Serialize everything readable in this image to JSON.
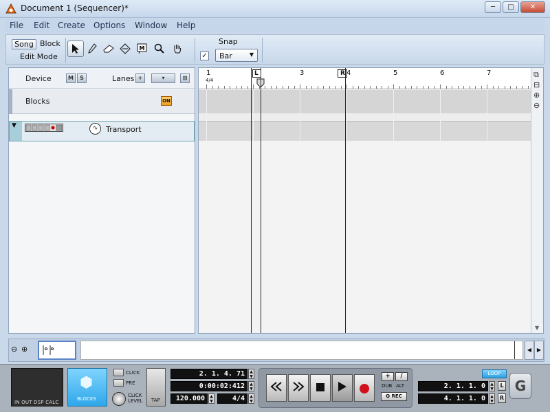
{
  "window": {
    "title": "Document 1 (Sequencer)*",
    "controls": {
      "minimize": "─",
      "maximize": "□",
      "close": "✕"
    }
  },
  "menu": [
    "File",
    "Edit",
    "Create",
    "Options",
    "Window",
    "Help"
  ],
  "toolbar": {
    "edit_mode": {
      "song": "Song",
      "block": "Block",
      "label": "Edit Mode"
    },
    "tools": [
      "arrow-icon",
      "pencil-icon",
      "eraser-icon",
      "razor-icon",
      "mute-icon",
      "magnify-icon",
      "hand-icon"
    ],
    "snap": {
      "label": "Snap",
      "checked": true,
      "check_glyph": "✓",
      "value": "Bar"
    }
  },
  "tracklist": {
    "device_label": "Device",
    "mute_label": "M",
    "solo_label": "S",
    "lanes_label": "Lanes",
    "blocks_label": "Blocks",
    "on_label": "ON",
    "transport_label": "Transport"
  },
  "ruler": {
    "bars": [
      "1",
      "2",
      "3",
      "4",
      "5",
      "6",
      "7"
    ],
    "signature": "4/4",
    "left_locator": "L",
    "right_locator": "R"
  },
  "transport": {
    "blocks_label": "BLOCKS",
    "click_label": "CLICK",
    "pre_label": "PRE",
    "click_level_label": "CLICK LEVEL",
    "tap_label": "TAP",
    "cpu_labels": "IN  OUT DSP CALC",
    "position": "2. 1. 4. 71",
    "time": "0:00:02:412",
    "tempo": "120.000",
    "signature": "4/4",
    "dub_label": "DUB",
    "alt_label": "ALT",
    "qrec_label": "Q REC",
    "loop_label": "LOOP",
    "left_locator": "2. 1. 1.   0",
    "right_locator": "4. 1. 1.   0",
    "l_label": "L",
    "r_label": "R",
    "logo": "G"
  }
}
